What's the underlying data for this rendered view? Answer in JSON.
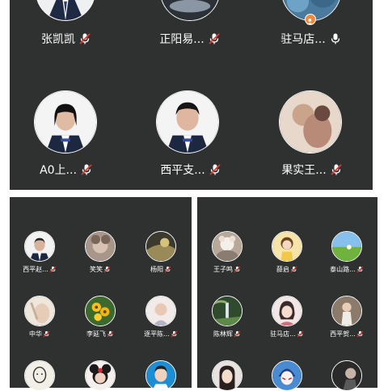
{
  "colors": {
    "panel_bg": "#2f3131",
    "page_bg": "#ffffff",
    "mute_red": "#e0382f",
    "badge_orange": "#f6883b"
  },
  "main_grid": {
    "participants": [
      {
        "name": "张凯凯",
        "mic": "muted-mic-icon"
      },
      {
        "name": "正阳易...",
        "mic": "muted-mic-icon"
      },
      {
        "name": "驻马店...",
        "mic": "mic-on-icon",
        "badge": "host-badge-icon"
      },
      {
        "name": "A0上...",
        "mic": "muted-mic-icon"
      },
      {
        "name": "西平支...",
        "mic": "muted-mic-icon"
      },
      {
        "name": "果实王...",
        "mic": "muted-mic-icon"
      }
    ]
  },
  "left_grid": {
    "participants": [
      {
        "name": "西平赵...",
        "mic": "muted-mic-icon"
      },
      {
        "name": "笑笑",
        "mic": "muted-mic-icon"
      },
      {
        "name": "杨阳",
        "mic": "muted-mic-icon"
      },
      {
        "name": "中华",
        "mic": "muted-mic-icon"
      },
      {
        "name": "李延飞",
        "mic": "muted-mic-icon"
      },
      {
        "name": "逐平陈...",
        "mic": "muted-mic-icon"
      },
      {
        "name": "",
        "mic": ""
      },
      {
        "name": "",
        "mic": ""
      },
      {
        "name": "",
        "mic": ""
      }
    ]
  },
  "right_grid": {
    "participants": [
      {
        "name": "王子鸣",
        "mic": "muted-mic-icon"
      },
      {
        "name": "薛启",
        "mic": "muted-mic-icon"
      },
      {
        "name": "泰山路...",
        "mic": "muted-mic-icon"
      },
      {
        "name": "陈林辉",
        "mic": "muted-mic-icon"
      },
      {
        "name": "驻马店...",
        "mic": "muted-mic-icon"
      },
      {
        "name": "西平贺...",
        "mic": "muted-mic-icon"
      },
      {
        "name": "",
        "mic": ""
      },
      {
        "name": "",
        "mic": ""
      },
      {
        "name": "",
        "mic": ""
      }
    ]
  }
}
